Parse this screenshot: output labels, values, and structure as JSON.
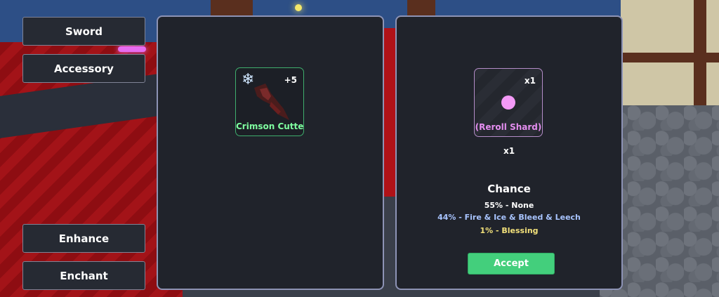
{
  "menu": {
    "sword_label": "Sword",
    "accessory_label": "Accessory",
    "enhance_label": "Enhance",
    "enchant_label": "Enchant"
  },
  "item": {
    "name": "Crimson Cutter",
    "level": "+5",
    "icon": "snowflake-icon",
    "name_color": "#7fffa0"
  },
  "shard": {
    "name": "(Reroll Shard)",
    "slot_count": "x1",
    "quantity": "x1",
    "name_color": "#e58ef0"
  },
  "chance": {
    "title": "Chance",
    "lines": [
      {
        "text": "55% - None",
        "color": "#ffffff"
      },
      {
        "text": "44% - Fire & Ice & Bleed & Leech",
        "color": "#a8c4ff"
      },
      {
        "text": "1% - Blessing",
        "color": "#f2e07a"
      }
    ]
  },
  "accept_label": "Accept",
  "colors": {
    "accent": "#43cf7c",
    "panel_border": "#8d93b5"
  }
}
